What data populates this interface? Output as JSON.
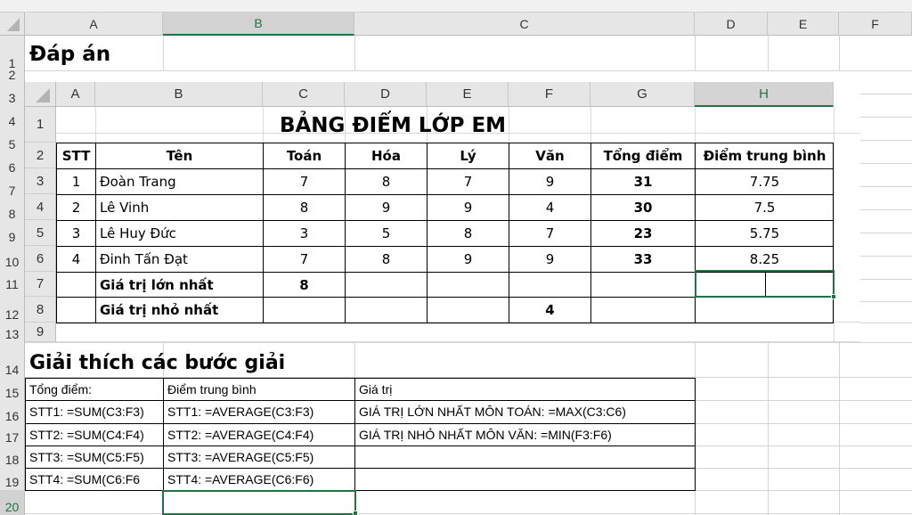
{
  "outer": {
    "columns": [
      "A",
      "B",
      "C",
      "D",
      "E",
      "F"
    ],
    "rows": [
      "1",
      "2",
      "3",
      "4",
      "5",
      "6",
      "7",
      "8",
      "9",
      "10",
      "11",
      "12",
      "13",
      "14",
      "15",
      "16",
      "17",
      "18",
      "19",
      "20"
    ],
    "title": "Đáp án",
    "section_title": "Giải thích các bước giải",
    "explanation": {
      "headers": [
        "Tổng điểm:",
        "Điểm trung bình",
        "Giá trị"
      ],
      "rows": [
        [
          "STT1: =SUM(C3:F3)",
          "STT1: =AVERAGE(C3:F3)",
          "GIÁ TRỊ LỚN NHẤT MÔN TOÁN: =MAX(C3:C6)"
        ],
        [
          "STT2: =SUM(C4:F4)",
          "STT2: =AVERAGE(C4:F4)",
          "GIÁ TRỊ NHỎ NHẤT MÔN VĂN: =MIN(F3:F6)"
        ],
        [
          "STT3: =SUM(C5:F5)",
          "STT3: =AVERAGE(C5:F5)",
          ""
        ],
        [
          "STT4: =SUM(C6:F6",
          "STT4: =AVERAGE(C6:F6)",
          ""
        ]
      ]
    }
  },
  "embedded": {
    "columns": [
      "A",
      "B",
      "C",
      "D",
      "E",
      "F",
      "G",
      "H"
    ],
    "rows": [
      "1",
      "2",
      "3",
      "4",
      "5",
      "6",
      "7",
      "8",
      "9"
    ],
    "title": "BẢNG ĐIỂM LỚP EM",
    "headers": [
      "STT",
      "Tên",
      "Toán",
      "Hóa",
      "Lý",
      "Văn",
      "Tổng điểm",
      "Điểm trung bình"
    ],
    "students": [
      {
        "stt": "1",
        "name": "Đoàn Trang",
        "toan": "7",
        "hoa": "8",
        "ly": "7",
        "van": "9",
        "total": "31",
        "avg": "7.75"
      },
      {
        "stt": "2",
        "name": "Lê Vinh",
        "toan": "8",
        "hoa": "9",
        "ly": "9",
        "van": "4",
        "total": "30",
        "avg": "7.5"
      },
      {
        "stt": "3",
        "name": "Lê Huy Đức",
        "toan": "3",
        "hoa": "5",
        "ly": "8",
        "van": "7",
        "total": "23",
        "avg": "5.75"
      },
      {
        "stt": "4",
        "name": "Đinh Tấn Đạt",
        "toan": "7",
        "hoa": "8",
        "ly": "9",
        "van": "9",
        "total": "33",
        "avg": "8.25"
      }
    ],
    "max_label": "Giá trị lớn nhất",
    "max_value": "8",
    "min_label": "Giá trị nhỏ nhất",
    "min_value": "4"
  },
  "colors": {
    "accent": "#217346",
    "header_bg": "#e6e6e6",
    "grid": "#d4d4d4"
  }
}
